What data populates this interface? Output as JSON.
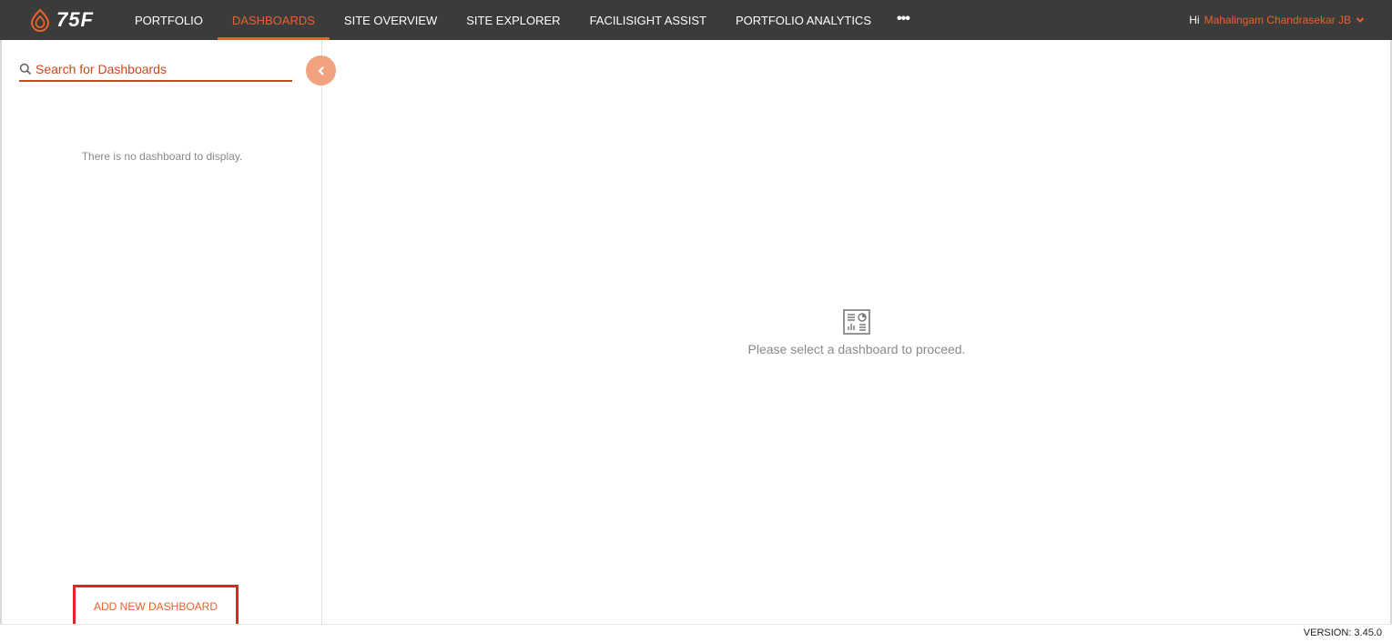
{
  "brand": {
    "logo_text": "75F",
    "accent": "#e8622d",
    "nav_bg": "#3b3b3b"
  },
  "nav": {
    "items": [
      {
        "label": "PORTFOLIO",
        "active": false
      },
      {
        "label": "DASHBOARDS",
        "active": true
      },
      {
        "label": "SITE OVERVIEW",
        "active": false
      },
      {
        "label": "SITE EXPLORER",
        "active": false
      },
      {
        "label": "FACILISIGHT ASSIST",
        "active": false
      },
      {
        "label": "PORTFOLIO ANALYTICS",
        "active": false
      }
    ],
    "more_label": "•••",
    "more_icon": "more-dots-icon"
  },
  "user": {
    "greeting": "Hi",
    "name": "Mahalingam Chandrasekar JB",
    "caret_icon": "chevron-down-icon"
  },
  "sidebar": {
    "search": {
      "placeholder": "Search for Dashboards",
      "value": "",
      "icon": "search-icon"
    },
    "collapse_icon": "chevron-left-icon",
    "empty_message": "There is no dashboard to display.",
    "add_button_label": "ADD NEW DASHBOARD",
    "highlight_color": "#e0242c"
  },
  "main": {
    "icon": "dashboard-icon",
    "message": "Please select a dashboard to proceed."
  },
  "footer": {
    "version": "VERSION: 3.45.0"
  }
}
